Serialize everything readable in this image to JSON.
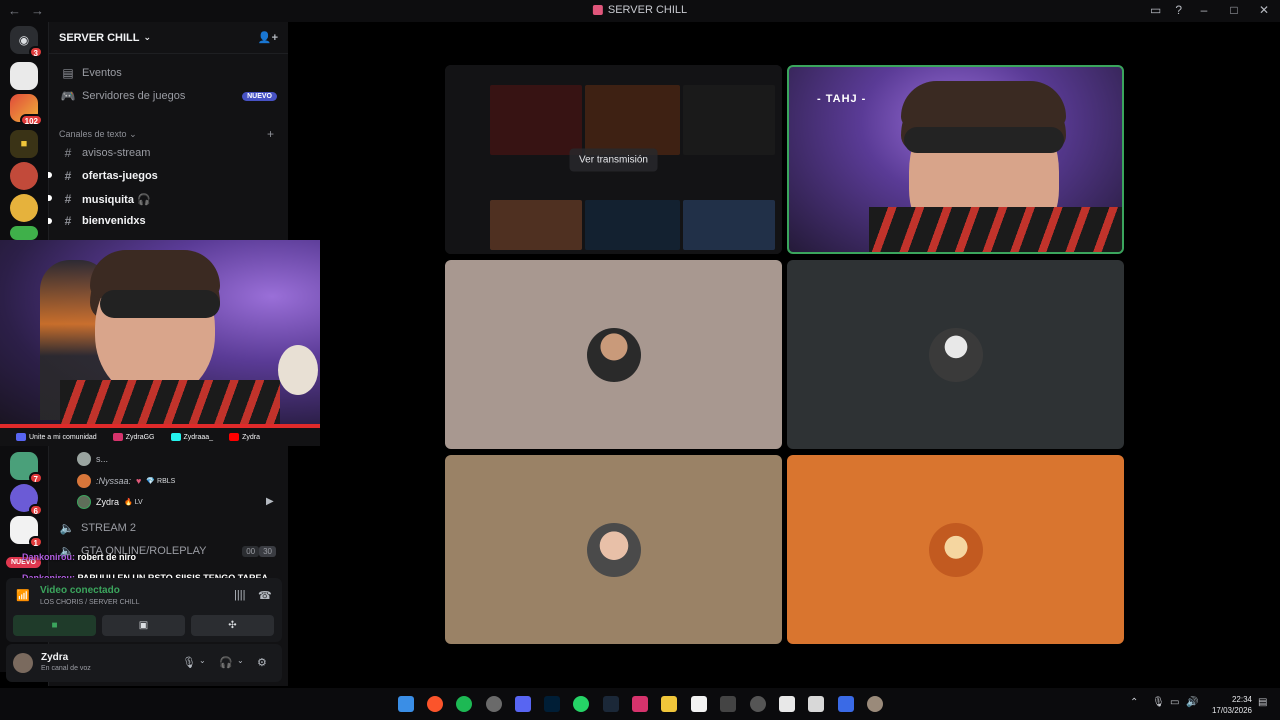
{
  "window": {
    "title": "SERVER CHILL"
  },
  "rail": {
    "badges": [
      "3",
      "102",
      "7",
      "6",
      "1"
    ]
  },
  "server": {
    "name": "SERVER CHILL",
    "events_label": "Eventos",
    "game_servers_label": "Servidores de juegos",
    "new_pill": "NUEVO",
    "category_text": "Canales de texto",
    "channels": [
      "avisos-stream",
      "ofertas-juegos",
      "musiquita 🎧",
      "bienvenidxs"
    ]
  },
  "overlay": {
    "socials": [
      "Unite a mi comunidad",
      "ZydraGG",
      "Zydraaa_",
      "Zydra"
    ]
  },
  "voice_users": [
    {
      "name": "s..."
    },
    {
      "name": ":Nyssaa:",
      "tag": "RBLS"
    },
    {
      "name": "Zydra",
      "tag": "LV"
    }
  ],
  "voice_channels": [
    {
      "name": "STREAM 2"
    },
    {
      "name": "GTA ONLINE/ROLEPLAY",
      "count_a": "00",
      "count_b": "30"
    }
  ],
  "chat": [
    {
      "name": "Dankonirou:",
      "text": "robert de niro"
    },
    {
      "name": "Dankonirou:",
      "text": "PAPUUU EN UN RSTO SIISIS TENGO TAREA"
    }
  ],
  "nuevo_badge": "NUEVO",
  "voice_panel": {
    "status": "Video conectado",
    "location": "LOS CHORIS / SERVER CHILL"
  },
  "user": {
    "name": "Zydra",
    "status": "En canal de voz"
  },
  "stage": {
    "watch_label": "Ver transmisión",
    "live_overlay_text": "- TAHJ -",
    "tile_colors": [
      "#a89890",
      "#2e3234",
      "#9a8266",
      "#d9752f"
    ]
  },
  "taskbar": {
    "time": "22:34",
    "date": "17/03/2026"
  }
}
